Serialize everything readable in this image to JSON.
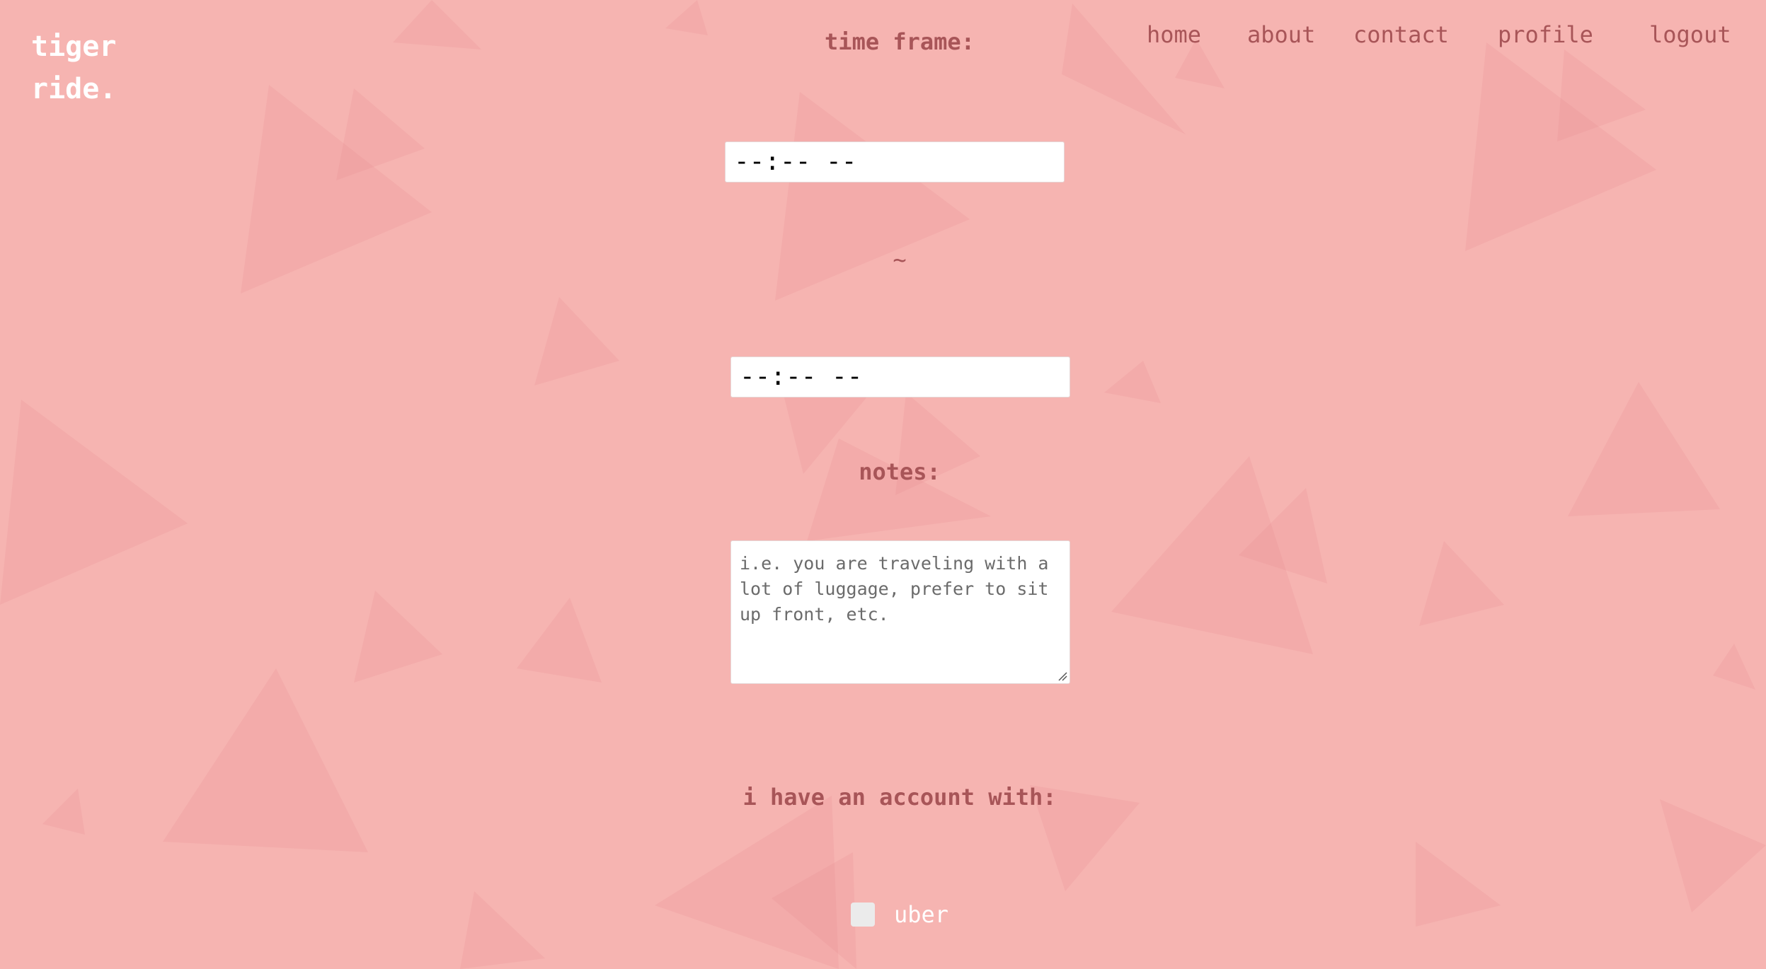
{
  "brand": {
    "line1": "tiger",
    "line2": "ride."
  },
  "nav": {
    "home": "home",
    "about": "about",
    "contact": "contact",
    "profile": "profile",
    "logout": "logout"
  },
  "form": {
    "time_frame_label": "time frame:",
    "start_time_value": "--:-- --",
    "separator": "~",
    "end_time_value": "--:-- --",
    "notes_label": "notes:",
    "notes_placeholder": "i.e. you are traveling with a lot of luggage, prefer to sit up front, etc.",
    "account_label": "i have an account with:",
    "accounts": [
      {
        "label": "uber",
        "checked": false
      }
    ]
  },
  "colors": {
    "background": "#f6b4b1",
    "text": "#a85558",
    "logo": "#ffffff",
    "triangles": "#e88f93"
  }
}
